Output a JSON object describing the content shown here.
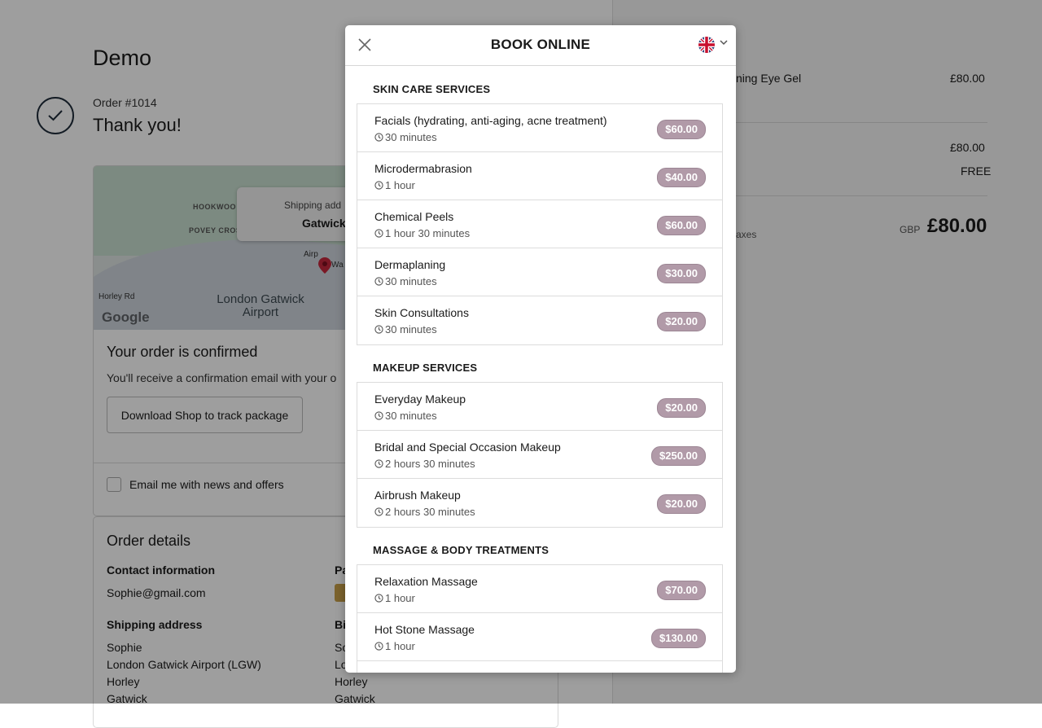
{
  "background": {
    "shop_title": "Demo",
    "order_number": "Order #1014",
    "thank_you": "Thank you!",
    "map": {
      "labels": [
        "HOOKWOO",
        "POVEY CROS",
        "Horley Rd",
        "Airp",
        "Wa"
      ],
      "airport": "London Gatwick Airport",
      "google": "Google",
      "shipping_popup_label": "Shipping add",
      "shipping_popup_value": "Gatwick"
    },
    "confirmed_title": "Your order is confirmed",
    "confirmed_text": "You'll receive a confirmation email with your o",
    "track_button": "Download Shop to track package",
    "email_opt_in": "Email me with news and offers",
    "details_title": "Order details",
    "contact_label": "Contact information",
    "contact_email": "Sophie@gmail.com",
    "payment_label": "Pa",
    "shipping_label": "Shipping address",
    "shipping_lines": [
      "Sophie",
      "London Gatwick Airport (LGW)",
      "Horley",
      "Gatwick"
    ],
    "billing_label": "Bi",
    "billing_lines": [
      "So",
      "Lo",
      "Horley",
      "Gatwick"
    ],
    "summary": {
      "item_name": "ning Eye Gel",
      "item_price": "£80.00",
      "subtotal": "£80.00",
      "shipping": "FREE",
      "taxes_note": "axes",
      "currency": "GBP",
      "total": "£80.00"
    }
  },
  "modal": {
    "title": "BOOK ONLINE",
    "language": "English (UK)",
    "sections": [
      {
        "heading": "SKIN CARE SERVICES",
        "services": [
          {
            "name": "Facials (hydrating, anti-aging, acne treatment)",
            "duration": "30 minutes",
            "price": "$60.00"
          },
          {
            "name": "Microdermabrasion",
            "duration": "1 hour",
            "price": "$40.00"
          },
          {
            "name": "Chemical Peels",
            "duration": "1 hour 30 minutes",
            "price": "$60.00"
          },
          {
            "name": "Dermaplaning",
            "duration": "30 minutes",
            "price": "$30.00"
          },
          {
            "name": "Skin Consultations",
            "duration": "30 minutes",
            "price": "$20.00"
          }
        ]
      },
      {
        "heading": "MAKEUP SERVICES",
        "services": [
          {
            "name": "Everyday Makeup",
            "duration": "30 minutes",
            "price": "$20.00"
          },
          {
            "name": "Bridal and Special Occasion Makeup",
            "duration": "2 hours 30 minutes",
            "price": "$250.00"
          },
          {
            "name": "Airbrush Makeup",
            "duration": "2 hours 30 minutes",
            "price": "$20.00"
          }
        ]
      },
      {
        "heading": "MASSAGE & BODY TREATMENTS",
        "services": [
          {
            "name": "Relaxation Massage",
            "duration": "1 hour",
            "price": "$70.00"
          },
          {
            "name": "Hot Stone Massage",
            "duration": "1 hour",
            "price": "$130.00"
          }
        ]
      }
    ]
  },
  "colors": {
    "price_badge": "#b19aa8",
    "overlay": "rgba(0,0,0,0.38)",
    "text": "#1a1a1a"
  }
}
